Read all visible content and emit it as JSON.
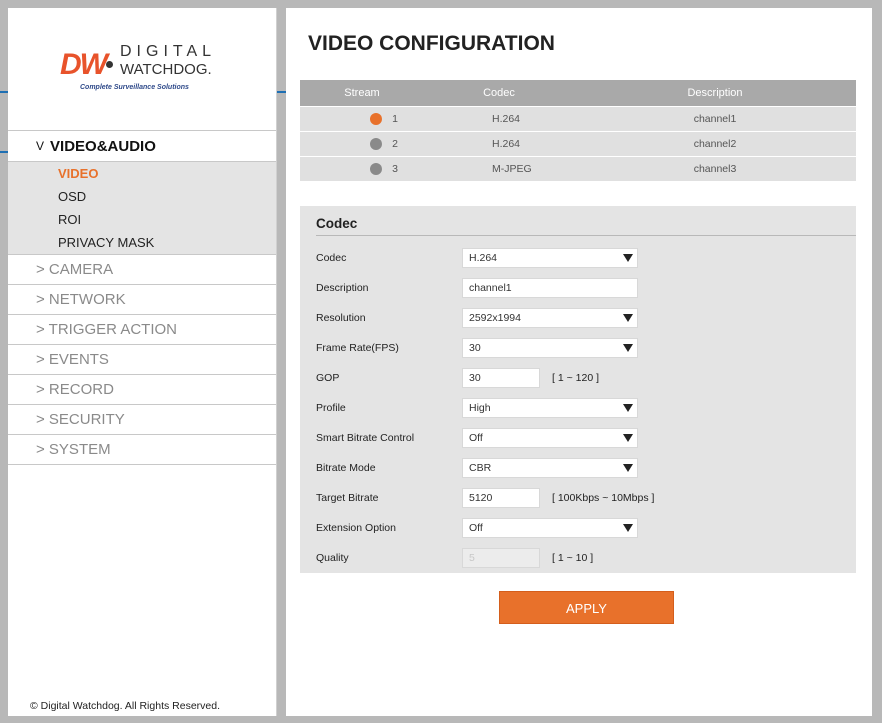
{
  "brand": {
    "dw": "DW",
    "line1": "DIGITAL",
    "line2": "WATCHDOG.",
    "tagline": "Complete Surveillance Solutions"
  },
  "sidebar": {
    "active_section": "VIDEO&AUDIO",
    "submenu": [
      "VIDEO",
      "OSD",
      "ROI",
      "PRIVACY MASK"
    ],
    "items": [
      "> CAMERA",
      "> NETWORK",
      "> TRIGGER ACTION",
      "> EVENTS",
      "> RECORD",
      "> SECURITY",
      "> SYSTEM"
    ],
    "copyright": "© Digital Watchdog. All Rights Reserved."
  },
  "page": {
    "title": "VIDEO CONFIGURATION"
  },
  "streams": {
    "headers": [
      "Stream",
      "Codec",
      "Description"
    ],
    "rows": [
      {
        "num": "1",
        "codec": "H.264",
        "description": "channel1",
        "selected": true
      },
      {
        "num": "2",
        "codec": "H.264",
        "description": "channel2",
        "selected": false
      },
      {
        "num": "3",
        "codec": "M-JPEG",
        "description": "channel3",
        "selected": false
      }
    ]
  },
  "codec_panel": {
    "title": "Codec",
    "fields": {
      "codec": {
        "label": "Codec",
        "value": "H.264"
      },
      "description": {
        "label": "Description",
        "value": "channel1"
      },
      "resolution": {
        "label": "Resolution",
        "value": "2592x1994"
      },
      "frame_rate": {
        "label": "Frame Rate(FPS)",
        "value": "30"
      },
      "gop": {
        "label": "GOP",
        "value": "30",
        "hint": "[ 1 ~ 120 ]"
      },
      "profile": {
        "label": "Profile",
        "value": "High"
      },
      "smart_bitrate": {
        "label": "Smart Bitrate Control",
        "value": "Off"
      },
      "bitrate_mode": {
        "label": "Bitrate Mode",
        "value": "CBR"
      },
      "target_bitrate": {
        "label": "Target Bitrate",
        "value": "5120",
        "hint": "[ 100Kbps ~ 10Mbps ]"
      },
      "extension": {
        "label": "Extension Option",
        "value": "Off"
      },
      "quality": {
        "label": "Quality",
        "value": "5",
        "hint": "[ 1 ~ 10 ]"
      }
    }
  },
  "apply_label": "APPLY",
  "colors": {
    "accent": "#e8712b",
    "callout": "#1e6fb3"
  }
}
